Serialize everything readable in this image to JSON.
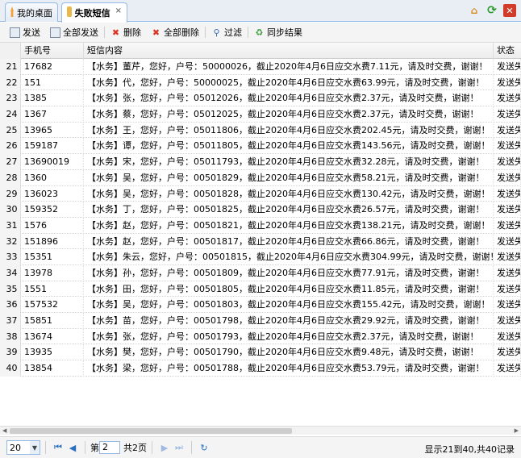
{
  "tabs": [
    {
      "label": "我的桌面",
      "icon": "home-icon"
    },
    {
      "label": "失败短信",
      "icon": "mail-icon",
      "close": "×"
    }
  ],
  "window_buttons": {
    "home": "⌂",
    "refresh": "⟳",
    "close": "✕"
  },
  "toolbar": [
    {
      "label": "发送",
      "icon": "send-icon",
      "glyph": "✉"
    },
    {
      "label": "全部发送",
      "icon": "send-all-icon",
      "glyph": "✉"
    },
    {
      "label": "删除",
      "icon": "delete-icon",
      "glyph": "✖"
    },
    {
      "label": "全部删除",
      "icon": "delete-all-icon",
      "glyph": "✖"
    },
    {
      "label": "过滤",
      "icon": "filter-icon",
      "glyph": "⚲"
    },
    {
      "label": "同步结果",
      "icon": "sync-icon",
      "glyph": "♻"
    }
  ],
  "columns": {
    "phone": "手机号",
    "content": "短信内容",
    "status": "状态"
  },
  "rows": [
    {
      "num": "21",
      "phone": "17682",
      "content": "【水务】董芹，您好，户号：50000026，截止2020年4月6日应交水费7.11元，请及时交费，谢谢！",
      "status": "发送失"
    },
    {
      "num": "22",
      "phone": "151",
      "content": "【水务】代，您好，户号：50000025，截止2020年4月6日应交水费63.99元，请及时交费，谢谢！",
      "status": "发送失"
    },
    {
      "num": "23",
      "phone": "1385",
      "content": "【水务】张，您好，户号：05012026，截止2020年4月6日应交水费2.37元，请及时交费，谢谢！",
      "status": "发送失"
    },
    {
      "num": "24",
      "phone": "1367",
      "content": "【水务】蔡，您好，户号：05012025，截止2020年4月6日应交水费2.37元，请及时交费，谢谢！",
      "status": "发送失"
    },
    {
      "num": "25",
      "phone": "13965",
      "content": "【水务】王，您好，户号：05011806，截止2020年4月6日应交水费202.45元，请及时交费，谢谢！",
      "status": "发送失"
    },
    {
      "num": "26",
      "phone": "159187",
      "content": "【水务】谭，您好，户号：05011805，截止2020年4月6日应交水费143.56元，请及时交费，谢谢！",
      "status": "发送失"
    },
    {
      "num": "27",
      "phone": "13690019",
      "content": "【水务】宋，您好，户号：05011793，截止2020年4月6日应交水费32.28元，请及时交费，谢谢！",
      "status": "发送失"
    },
    {
      "num": "28",
      "phone": "1360",
      "content": "【水务】吴，您好，户号：00501829，截止2020年4月6日应交水费58.21元，请及时交费，谢谢！",
      "status": "发送失"
    },
    {
      "num": "29",
      "phone": "136023",
      "content": "【水务】吴，您好，户号：00501828，截止2020年4月6日应交水费130.42元，请及时交费，谢谢！",
      "status": "发送失"
    },
    {
      "num": "30",
      "phone": "159352",
      "content": "【水务】丁，您好，户号：00501825，截止2020年4月6日应交水费26.57元，请及时交费，谢谢！",
      "status": "发送失"
    },
    {
      "num": "31",
      "phone": "1576",
      "content": "【水务】赵，您好，户号：00501821，截止2020年4月6日应交水费138.21元，请及时交费，谢谢！",
      "status": "发送失"
    },
    {
      "num": "32",
      "phone": "151896",
      "content": "【水务】赵，您好，户号：00501817，截止2020年4月6日应交水费66.86元，请及时交费，谢谢！",
      "status": "发送失"
    },
    {
      "num": "33",
      "phone": "15351",
      "content": "【水务】朱云，您好，户号：00501815，截止2020年4月6日应交水费304.99元，请及时交费，谢谢！",
      "status": "发送失"
    },
    {
      "num": "34",
      "phone": "13978",
      "content": "【水务】孙，您好，户号：00501809，截止2020年4月6日应交水费77.91元，请及时交费，谢谢！",
      "status": "发送失"
    },
    {
      "num": "35",
      "phone": "1551",
      "content": "【水务】田，您好，户号：00501805，截止2020年4月6日应交水费11.85元，请及时交费，谢谢！",
      "status": "发送失"
    },
    {
      "num": "36",
      "phone": "157532",
      "content": "【水务】吴，您好，户号：00501803，截止2020年4月6日应交水费155.42元，请及时交费，谢谢！",
      "status": "发送失"
    },
    {
      "num": "37",
      "phone": "15851",
      "content": "【水务】苗，您好，户号：00501798，截止2020年4月6日应交水费29.92元，请及时交费，谢谢！",
      "status": "发送失"
    },
    {
      "num": "38",
      "phone": "13674",
      "content": "【水务】张，您好，户号：00501793，截止2020年4月6日应交水费2.37元，请及时交费，谢谢！",
      "status": "发送失"
    },
    {
      "num": "39",
      "phone": "13935",
      "content": "【水务】樊，您好，户号：00501790，截止2020年4月6日应交水费9.48元，请及时交费，谢谢！",
      "status": "发送失"
    },
    {
      "num": "40",
      "phone": "13854",
      "content": "【水务】梁，您好，户号：00501788，截止2020年4月6日应交水费53.79元，请及时交费，谢谢！",
      "status": "发送失"
    }
  ],
  "pager": {
    "page_size": "20",
    "page_prefix": "第",
    "page_value": "2",
    "page_total": "共2页",
    "info": "显示21到40,共40记录"
  }
}
